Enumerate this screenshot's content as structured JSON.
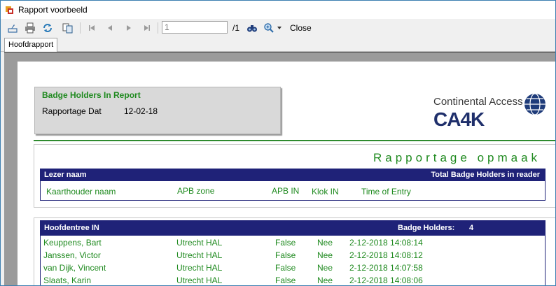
{
  "window": {
    "title": "Rapport voorbeeld"
  },
  "toolbar": {
    "page_value": "1",
    "page_total": "/1",
    "close_label": "Close",
    "icons": [
      "page-setup-icon",
      "print-icon",
      "refresh-icon",
      "export-icon",
      "first-page-icon",
      "previous-page-icon",
      "next-page-icon",
      "last-page-icon",
      "find-icon",
      "zoom-icon",
      "chevron-down-icon"
    ]
  },
  "tabs": [
    {
      "label": "Hoofdrapport"
    }
  ],
  "report": {
    "header": {
      "title": "Badge Holders In Report",
      "date_label": "Rapportage Dat",
      "date_value": "12-02-18"
    },
    "logo": {
      "line1": "Continental Access",
      "line2": "CA4K"
    },
    "section_title": "Rapportage opmaak",
    "reader_bar": {
      "left": "Lezer naam",
      "right": "Total Badge Holders in reader"
    },
    "columns": [
      "Kaarthouder naam",
      "APB zone",
      "APB IN",
      "Klok IN",
      "Time of Entry"
    ],
    "group": {
      "name": "Hoofdentree IN",
      "badge_label": "Badge Holders:",
      "badge_count": "4",
      "rows": [
        {
          "name": "Keuppens, Bart",
          "zone": "Utrecht HAL",
          "apb": "False",
          "klok": "Nee",
          "time": "2-12-2018 14:08:14"
        },
        {
          "name": "Janssen, Victor",
          "zone": "Utrecht HAL",
          "apb": "False",
          "klok": "Nee",
          "time": "2-12-2018 14:08:12"
        },
        {
          "name": "van Dijk, Vincent",
          "zone": "Utrecht HAL",
          "apb": "False",
          "klok": "Nee",
          "time": "2-12-2018 14:07:58"
        },
        {
          "name": "Slaats, Karin",
          "zone": "Utrecht HAL",
          "apb": "False",
          "klok": "Nee",
          "time": "2-12-2018 14:08:06"
        }
      ]
    }
  },
  "colors": {
    "accent_green": "#1f8a1f",
    "bar_navy": "#1f2278",
    "window_border": "#3c7fb1"
  }
}
